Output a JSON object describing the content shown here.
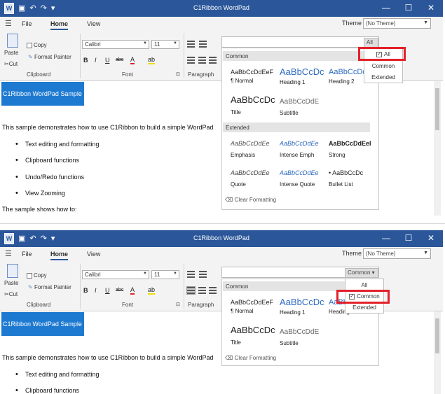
{
  "colors": {
    "titlebar": "#2b579a",
    "accent": "#1e7ad1",
    "highlight": "#e3202a"
  },
  "icons": {
    "undo": "undo-icon",
    "redo": "redo-icon",
    "save": "save-icon",
    "menu": "hamburger-icon",
    "clear": "eraser-icon"
  },
  "app_title": "C1Ribbon WordPad",
  "window_controls": {
    "minimize": "—",
    "maximize": "☐",
    "close": "✕"
  },
  "tabs": {
    "file": "File",
    "home": "Home",
    "view": "View"
  },
  "theme": {
    "label": "Theme",
    "value": "(No Theme)"
  },
  "clipboard": {
    "paste": "Paste",
    "copy": "Copy",
    "cut": "Cut",
    "format_painter": "Format Painter",
    "group": "Clipboard"
  },
  "font": {
    "family": "Calibri",
    "size": "11",
    "bold": "B",
    "italic": "I",
    "underline": "U",
    "strike": "abc",
    "color_a": "A",
    "group": "Font",
    "launcher": "⊡"
  },
  "paragraph": {
    "group": "Paragraph"
  },
  "gallery": {
    "footer": "Clear Formatting",
    "categories": {
      "common": "Common",
      "extended": "Extended"
    },
    "common_styles": [
      {
        "sample": "AaBbCcDdEeF",
        "name": "¶ Normal"
      },
      {
        "sample": "AaBbCcDc",
        "name": "Heading 1"
      },
      {
        "sample": "AaBbCcDd",
        "name": "Heading 2"
      },
      {
        "sample": "AaBbCcDc",
        "name": "Title"
      },
      {
        "sample": "AaBbCcDdE",
        "name": "Subtitle"
      }
    ],
    "extended_styles": [
      {
        "sample": "AaBbCcDdEe",
        "name": "Emphasis"
      },
      {
        "sample": "AaBbCcDdEe",
        "name": "Intense Emph"
      },
      {
        "sample": "AaBbCcDdEeI",
        "name": "Strong"
      },
      {
        "sample": "AaBbCcDdEe",
        "name": "Quote"
      },
      {
        "sample": "AaBbCcDdEe",
        "name": "Intense Quote"
      },
      {
        "sample": "•  AaBbCcDc",
        "name": "Bullet List"
      }
    ]
  },
  "panel1": {
    "filter_value": "All",
    "filter_options": [
      {
        "label": "All",
        "checked": true
      },
      {
        "label": "Common",
        "checked": false
      },
      {
        "label": "Extended",
        "checked": false
      }
    ]
  },
  "panel2": {
    "filter_value": "Common",
    "filter_options": [
      {
        "label": "All",
        "checked": false
      },
      {
        "label": "Common",
        "checked": true
      },
      {
        "label": "Extended",
        "checked": false
      }
    ]
  },
  "document": {
    "title": "C1Ribbon WordPad Sample",
    "intro": "This sample demonstrates how to use C1Ribbon to build a simple WordPad",
    "bullets": [
      "Text editing and formatting",
      "Clipboard functions",
      "Undo/Redo functions",
      "View Zooming"
    ],
    "shows": "The sample shows how to:"
  }
}
